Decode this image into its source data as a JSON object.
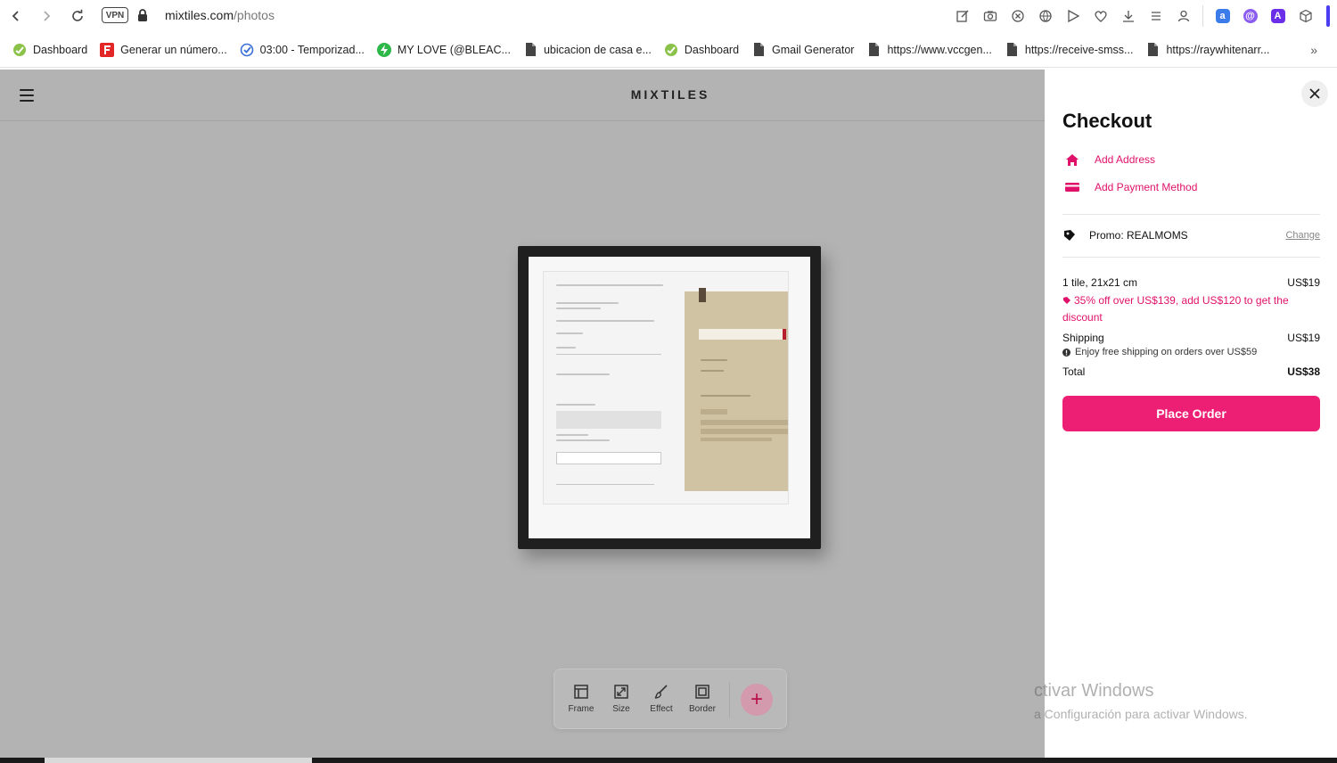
{
  "browser": {
    "url_host": "mixtiles.com",
    "url_path": "/photos",
    "vpn_label": "VPN",
    "ext_translate": "a",
    "ext_a": "A"
  },
  "bookmarks": [
    {
      "label": "Dashboard",
      "icon": "dashboard-icon"
    },
    {
      "label": "Generar un número...",
      "icon": "f-logo-icon"
    },
    {
      "label": "03:00 - Temporizad...",
      "icon": "timer-check-icon"
    },
    {
      "label": "MY LOVE (@BLEAC...",
      "icon": "bolt-icon"
    },
    {
      "label": "ubicacion de casa e...",
      "icon": "file-icon"
    },
    {
      "label": "Dashboard",
      "icon": "dashboard-icon"
    },
    {
      "label": "Gmail Generator",
      "icon": "file-icon"
    },
    {
      "label": "https://www.vccgen...",
      "icon": "file-icon"
    },
    {
      "label": "https://receive-smss...",
      "icon": "file-icon"
    },
    {
      "label": "https://raywhitenarr...",
      "icon": "file-icon"
    }
  ],
  "app": {
    "logo": "MIXTILES",
    "tools": [
      {
        "label": "Frame",
        "icon": "frame-icon"
      },
      {
        "label": "Size",
        "icon": "resize-icon"
      },
      {
        "label": "Effect",
        "icon": "brush-icon"
      },
      {
        "label": "Border",
        "icon": "border-icon"
      }
    ],
    "add_symbol": "+"
  },
  "checkout": {
    "title": "Checkout",
    "add_address": "Add Address",
    "add_payment": "Add Payment Method",
    "promo": "Promo: REALMOMS",
    "change": "Change",
    "item_label": "1 tile, 21x21 cm",
    "item_price": "US$19",
    "discount_note": "35% off over US$139, add US$120 to get the discount",
    "shipping_label": "Shipping",
    "shipping_price": "US$19",
    "shipping_note": "Enjoy free shipping on orders over US$59",
    "total_label": "Total",
    "total_price": "US$38",
    "place_order": "Place Order",
    "accent_color": "#ec1f74"
  },
  "watermark": {
    "title": "ctivar Windows",
    "subtitle": "a Configuración para activar Windows."
  }
}
